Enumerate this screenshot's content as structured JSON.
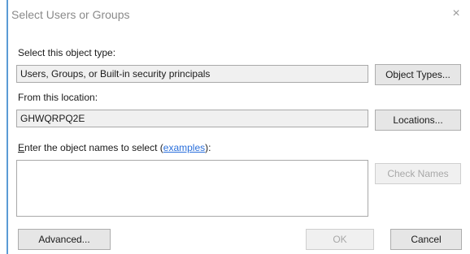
{
  "dialog": {
    "title": "Select Users or Groups",
    "close_label": "×"
  },
  "object_type": {
    "label": "Select this object type:",
    "value": "Users, Groups, or Built-in security principals",
    "button": "Object Types..."
  },
  "location": {
    "label": "From this location:",
    "value": "GHWQRPQ2E",
    "button": "Locations..."
  },
  "names": {
    "label_prefix_underlined": "E",
    "label_prefix_rest": "nter the object names to select (",
    "label_link": "examples",
    "label_suffix": "):",
    "value": "",
    "check_button": "Check Names"
  },
  "footer": {
    "advanced_button": "Advanced...",
    "ok_button": "OK",
    "cancel_button": "Cancel"
  }
}
